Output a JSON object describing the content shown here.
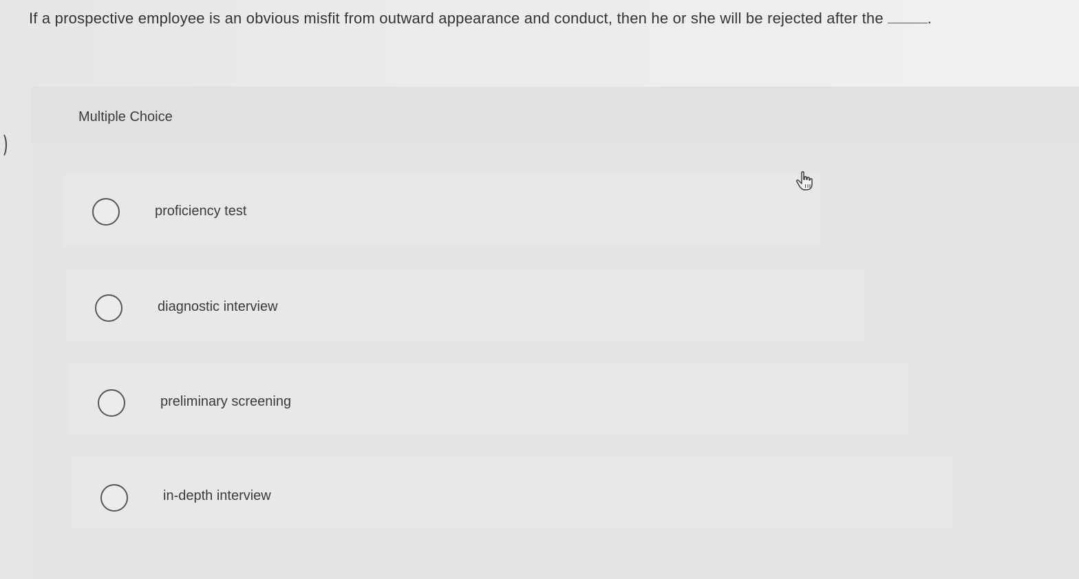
{
  "question": {
    "text": "If a prospective employee is an obvious misfit from outward appearance and conduct, then he or she will be rejected after the",
    "terminal": "."
  },
  "panel": {
    "label": "Multiple Choice"
  },
  "options": [
    {
      "label": "proficiency test"
    },
    {
      "label": "diagnostic interview"
    },
    {
      "label": "preliminary screening"
    },
    {
      "label": "in-depth interview"
    }
  ],
  "colors": {
    "background": "#ececec",
    "panel": "#e4e4e4",
    "text": "#3a3a3a",
    "radio_border": "#555555"
  },
  "icons": {
    "cursor": "hand-pointer-icon"
  }
}
